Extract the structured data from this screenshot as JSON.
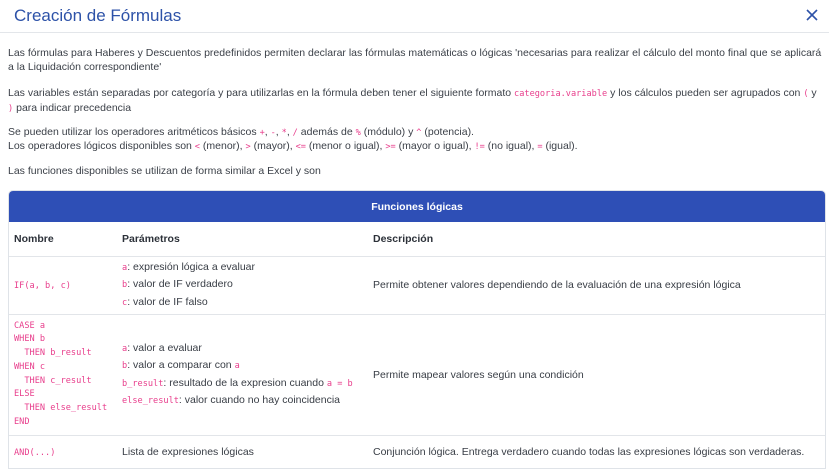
{
  "header": {
    "title": "Creación de Fórmulas",
    "close_label": "×"
  },
  "intro": {
    "p1": "Las fórmulas para Haberes y Descuentos predefinidos permiten declarar las fórmulas matemáticas o lógicas 'necesarias para realizar el cálculo del monto final que se aplicará a la Liquidación correspondiente'",
    "p2_a": "Las variables están separadas por categoría y para utilizarlas en la fórmula deben tener el siguiente formato ",
    "p2_code": "categoria.variable",
    "p2_b": " y los cálculos pueden ser agrupados con ",
    "p2_paren_open": "(",
    "p2_y": " y ",
    "p2_paren_close": ")",
    "p2_c": " para indicar precedencia",
    "p3_a": "Se pueden utilizar los operadores aritméticos básicos ",
    "op_plus": "+",
    "op_minus": "-",
    "op_mul": "*",
    "op_div": "/",
    "p3_b": " además de ",
    "op_mod": "%",
    "p3_c": " (módulo) y ",
    "op_pow": "^",
    "p3_d": " (potencia).",
    "p4_a": "Los operadores lógicos disponibles son ",
    "op_lt": "<",
    "p4_b": " (menor), ",
    "op_gt": ">",
    "p4_c": " (mayor), ",
    "op_lte": "<=",
    "p4_d": " (menor o igual), ",
    "op_gte": ">=",
    "p4_e": " (mayor o igual), ",
    "op_neq": "!=",
    "p4_f": " (no igual), ",
    "op_eq": "=",
    "p4_g": " (igual).",
    "p5": "Las funciones disponibles se utilizan de forma similar a Excel y son"
  },
  "table": {
    "title": "Funciones lógicas",
    "columns": [
      "Nombre",
      "Parámetros",
      "Descripción"
    ],
    "rows": [
      {
        "name": "IF(a, b, c)",
        "params": [
          {
            "code": "a",
            "text": ": expresión lógica a evaluar"
          },
          {
            "code": "b",
            "text": ": valor de IF verdadero"
          },
          {
            "code": "c",
            "text": ": valor de IF falso"
          }
        ],
        "description": "Permite obtener valores dependiendo de la evaluación de una expresión lógica"
      },
      {
        "name": "CASE a\nWHEN b\n  THEN b_result\nWHEN c\n  THEN c_result\nELSE\n  THEN else_result\nEND",
        "params": [
          {
            "code": "a",
            "text": ": valor a evaluar"
          },
          {
            "code": "b",
            "text": ": valor a comparar con ",
            "code2": "a"
          },
          {
            "code": "b_result",
            "text": ": resultado de la expresion cuando ",
            "code2": "a = b"
          },
          {
            "code": "else_result",
            "text": ": valor cuando no hay coincidencia"
          }
        ],
        "description": "Permite mapear valores según una condición"
      },
      {
        "name": "AND(...)",
        "params_text": "Lista de expresiones lógicas",
        "description": "Conjunción lógica. Entrega verdadero cuando todas las expresiones lógicas son verdaderas."
      }
    ]
  }
}
